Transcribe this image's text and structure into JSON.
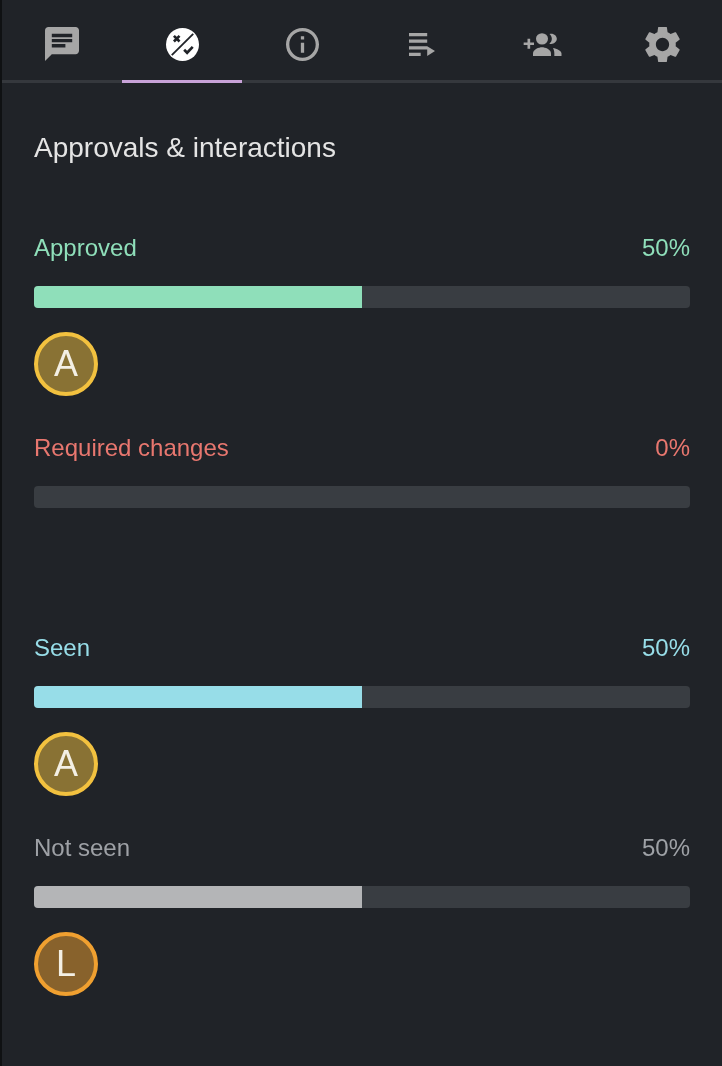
{
  "tabs": [
    {
      "kind": "comments",
      "selected": false
    },
    {
      "kind": "approvals",
      "selected": true
    },
    {
      "kind": "info",
      "selected": false
    },
    {
      "kind": "playlist",
      "selected": false
    },
    {
      "kind": "add_people",
      "selected": false
    },
    {
      "kind": "settings",
      "selected": false
    }
  ],
  "heading": "Approvals & interactions",
  "groups": [
    {
      "label": "Approved",
      "reading": "50%",
      "color": "#8fdfba",
      "bar": {
        "level": 0.5,
        "color": "#8fdfba"
      },
      "avatars": [
        {
          "initial": "A",
          "color": "#f2c13f"
        }
      ]
    },
    {
      "label": "Required changes",
      "reading": "0%",
      "color": "#e8776f"
    },
    {
      "label": "Seen",
      "reading": "50%",
      "color": "#97dde8",
      "bar": {
        "level": 0.5,
        "color": "#97dde8"
      },
      "avatars": [
        {
          "initial": "A",
          "color": "#f2c13f"
        }
      ]
    },
    {
      "label": "Not seen",
      "reading": "50%",
      "color": "#9ea1a6",
      "bar": {
        "level": 0.5,
        "color": "#b4b5b7"
      },
      "avatars": [
        {
          "initial": "L",
          "color": "#f0a030"
        }
      ]
    }
  ]
}
